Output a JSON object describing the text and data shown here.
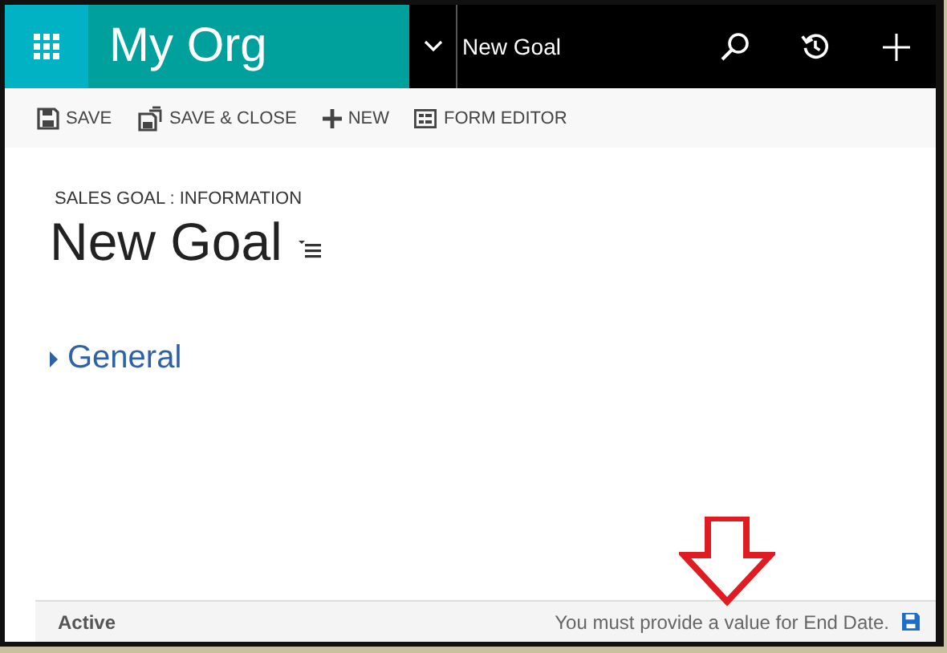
{
  "nav": {
    "org": "My Org",
    "record": "New Goal"
  },
  "toolbar": [
    {
      "kind": "save",
      "label": "SAVE"
    },
    {
      "kind": "save-close",
      "label": "SAVE & CLOSE"
    },
    {
      "kind": "new",
      "label": "NEW"
    },
    {
      "kind": "form",
      "label": "FORM EDITOR"
    }
  ],
  "header": {
    "entity": "SALES GOAL : INFORMATION",
    "title": "New Goal"
  },
  "sections": [
    {
      "label": "General",
      "expanded": false
    }
  ],
  "status_bar": {
    "state": "Active",
    "message": "You must provide a value for End Date."
  }
}
